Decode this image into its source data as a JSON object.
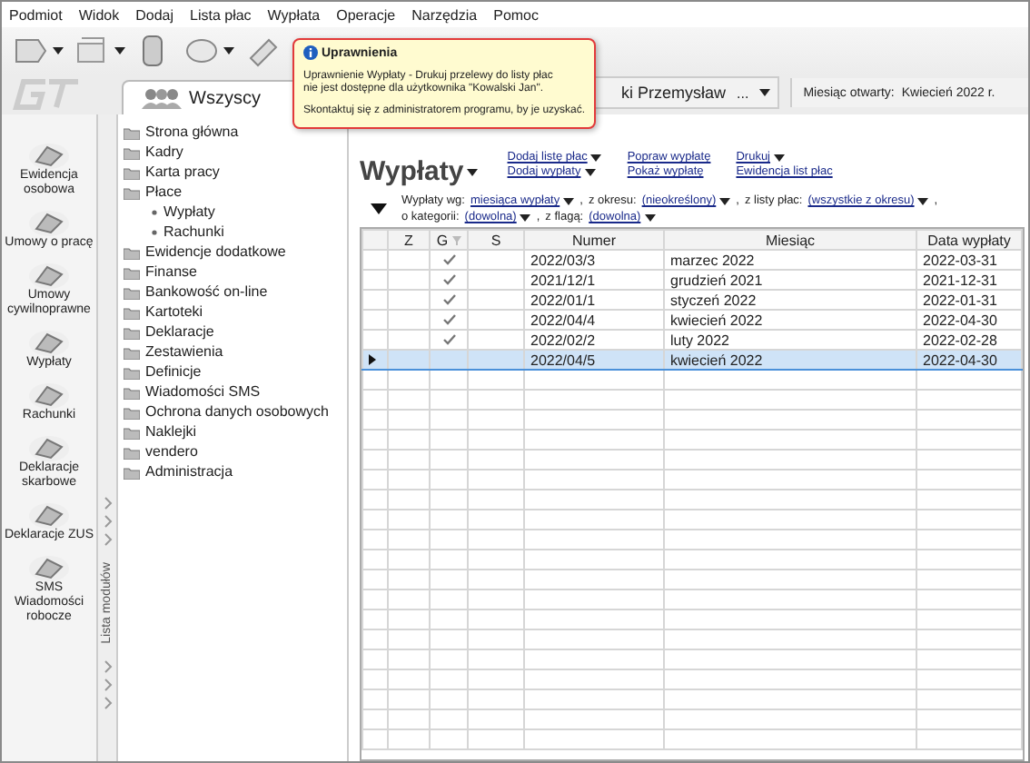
{
  "menu": [
    "Podmiot",
    "Widok",
    "Dodaj",
    "Lista płac",
    "Wypłata",
    "Operacje",
    "Narzędzia",
    "Pomoc"
  ],
  "tabs": [
    {
      "label": "Wszyscy",
      "selected": true
    }
  ],
  "header_bar": {
    "employee": "ki Przemysław",
    "more": "...",
    "month_label": "Miesiąc otwarty:",
    "month_value": "Kwiecień 2022 r."
  },
  "tooltip": {
    "title": "Uprawnienia",
    "message": "Uprawnienie Wypłaty - Drukuj przelewy do listy płac\nnie jest dostępne dla użytkownika \"Kowalski Jan\".",
    "hint": "Skontaktuj się z administratorem programu, by je uzyskać."
  },
  "modules": [
    {
      "label": "Ewidencja osobowa"
    },
    {
      "label": "Umowy o pracę"
    },
    {
      "label": "Umowy cywilnoprawne"
    },
    {
      "label": "Wypłaty"
    },
    {
      "label": "Rachunki"
    },
    {
      "label": "Deklaracje skarbowe"
    },
    {
      "label": "Deklaracje ZUS"
    },
    {
      "label": "SMS Wiadomości robocze"
    }
  ],
  "module_strip": {
    "label": "Lista modułów"
  },
  "tree": [
    {
      "label": "Strona główna"
    },
    {
      "label": "Kadry"
    },
    {
      "label": "Karta pracy"
    },
    {
      "label": "Płace",
      "children": [
        {
          "label": "Wypłaty"
        },
        {
          "label": "Rachunki"
        }
      ]
    },
    {
      "label": "Ewidencje dodatkowe"
    },
    {
      "label": "Finanse"
    },
    {
      "label": "Bankowość on-line"
    },
    {
      "label": "Kartoteki"
    },
    {
      "label": "Deklaracje"
    },
    {
      "label": "Zestawienia"
    },
    {
      "label": "Definicje"
    },
    {
      "label": "Wiadomości SMS"
    },
    {
      "label": "Ochrona danych osobowych"
    },
    {
      "label": "Naklejki"
    },
    {
      "label": "vendero"
    },
    {
      "label": "Administracja"
    }
  ],
  "page_title": "Wypłaty",
  "actions": [
    [
      {
        "label": "Dodaj listę płac",
        "dropdown": true
      },
      {
        "label": "Dodaj wypłaty",
        "dropdown": true
      }
    ],
    [
      {
        "label": "Popraw wypłatę",
        "dropdown": false
      },
      {
        "label": "Pokaż wypłatę",
        "dropdown": false
      }
    ],
    [
      {
        "label": "Drukuj",
        "dropdown": true
      },
      {
        "label": "Ewidencja list płac",
        "dropdown": false
      }
    ]
  ],
  "filters": [
    [
      {
        "label": "Wypłaty wg:",
        "value": "miesiąca wypłaty",
        "suffix": ","
      },
      {
        "label": "z okresu:",
        "value": "(nieokreślony)",
        "suffix": ","
      },
      {
        "label": "z listy płac:",
        "value": "(wszystkie z okresu)",
        "suffix": ","
      }
    ],
    [
      {
        "label": "o kategorii:",
        "value": "(dowolna)",
        "suffix": ","
      },
      {
        "label": "z flagą:",
        "value": "(dowolna)"
      }
    ]
  ],
  "table": {
    "columns": [
      "Z",
      "G",
      "S",
      "Numer",
      "Miesiąc",
      "Data wypłaty"
    ],
    "rows": [
      {
        "g_checked": true,
        "numer": "2022/03/3",
        "miesiac": "marzec 2022",
        "data": "2022-03-31",
        "selected": false
      },
      {
        "g_checked": true,
        "numer": "2021/12/1",
        "miesiac": "grudzień 2021",
        "data": "2021-12-31",
        "selected": false
      },
      {
        "g_checked": true,
        "numer": "2022/01/1",
        "miesiac": "styczeń 2022",
        "data": "2022-01-31",
        "selected": false
      },
      {
        "g_checked": true,
        "numer": "2022/04/4",
        "miesiac": "kwiecień 2022",
        "data": "2022-04-30",
        "selected": false
      },
      {
        "g_checked": true,
        "numer": "2022/02/2",
        "miesiac": "luty 2022",
        "data": "2022-02-28",
        "selected": false
      },
      {
        "g_checked": false,
        "numer": "2022/04/5",
        "miesiac": "kwiecień 2022",
        "data": "2022-04-30",
        "selected": true
      }
    ]
  }
}
